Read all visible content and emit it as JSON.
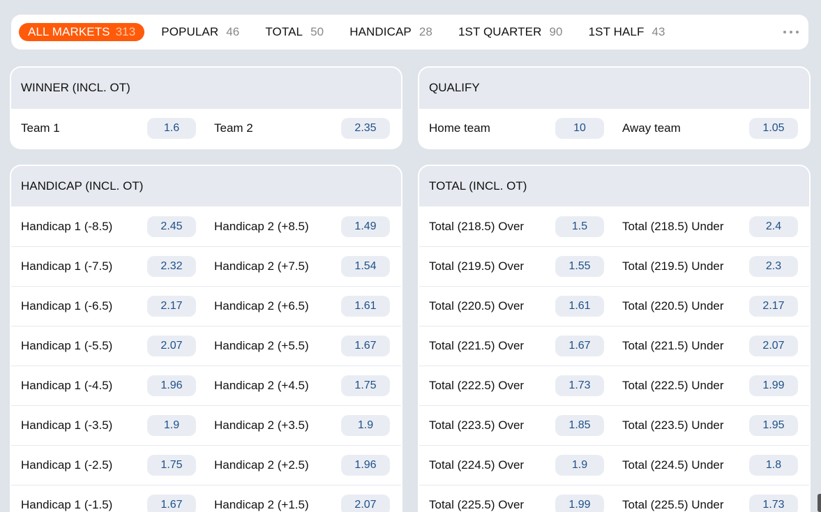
{
  "tabs": [
    {
      "label": "ALL MARKETS",
      "count": "313"
    },
    {
      "label": "POPULAR",
      "count": "46"
    },
    {
      "label": "TOTAL",
      "count": "50"
    },
    {
      "label": "HANDICAP",
      "count": "28"
    },
    {
      "label": "1ST QUARTER",
      "count": "90"
    },
    {
      "label": "1ST HALF",
      "count": "43"
    }
  ],
  "markets": {
    "winner": {
      "title": "WINNER (INCL. OT)",
      "rows": [
        [
          {
            "name": "Team 1",
            "odd": "1.6"
          },
          {
            "name": "Team 2",
            "odd": "2.35"
          }
        ]
      ]
    },
    "qualify": {
      "title": "QUALIFY",
      "rows": [
        [
          {
            "name": "Home team",
            "odd": "10"
          },
          {
            "name": "Away team",
            "odd": "1.05"
          }
        ]
      ]
    },
    "handicap": {
      "title": "HANDICAP (INCL. OT)",
      "rows": [
        [
          {
            "name": "Handicap 1 (-8.5)",
            "odd": "2.45"
          },
          {
            "name": "Handicap 2 (+8.5)",
            "odd": "1.49"
          }
        ],
        [
          {
            "name": "Handicap 1 (-7.5)",
            "odd": "2.32"
          },
          {
            "name": "Handicap 2 (+7.5)",
            "odd": "1.54"
          }
        ],
        [
          {
            "name": "Handicap 1 (-6.5)",
            "odd": "2.17"
          },
          {
            "name": "Handicap 2 (+6.5)",
            "odd": "1.61"
          }
        ],
        [
          {
            "name": "Handicap 1 (-5.5)",
            "odd": "2.07"
          },
          {
            "name": "Handicap 2 (+5.5)",
            "odd": "1.67"
          }
        ],
        [
          {
            "name": "Handicap 1 (-4.5)",
            "odd": "1.96"
          },
          {
            "name": "Handicap 2 (+4.5)",
            "odd": "1.75"
          }
        ],
        [
          {
            "name": "Handicap 1 (-3.5)",
            "odd": "1.9"
          },
          {
            "name": "Handicap 2 (+3.5)",
            "odd": "1.9"
          }
        ],
        [
          {
            "name": "Handicap 1 (-2.5)",
            "odd": "1.75"
          },
          {
            "name": "Handicap 2 (+2.5)",
            "odd": "1.96"
          }
        ],
        [
          {
            "name": "Handicap 1 (-1.5)",
            "odd": "1.67"
          },
          {
            "name": "Handicap 2 (+1.5)",
            "odd": "2.07"
          }
        ]
      ]
    },
    "total": {
      "title": "TOTAL (INCL. OT)",
      "rows": [
        [
          {
            "name": "Total (218.5) Over",
            "odd": "1.5"
          },
          {
            "name": "Total (218.5) Under",
            "odd": "2.4"
          }
        ],
        [
          {
            "name": "Total (219.5) Over",
            "odd": "1.55"
          },
          {
            "name": "Total (219.5) Under",
            "odd": "2.3"
          }
        ],
        [
          {
            "name": "Total (220.5) Over",
            "odd": "1.61"
          },
          {
            "name": "Total (220.5) Under",
            "odd": "2.17"
          }
        ],
        [
          {
            "name": "Total (221.5) Over",
            "odd": "1.67"
          },
          {
            "name": "Total (221.5) Under",
            "odd": "2.07"
          }
        ],
        [
          {
            "name": "Total (222.5) Over",
            "odd": "1.73"
          },
          {
            "name": "Total (222.5) Under",
            "odd": "1.99"
          }
        ],
        [
          {
            "name": "Total (223.5) Over",
            "odd": "1.85"
          },
          {
            "name": "Total (223.5) Under",
            "odd": "1.95"
          }
        ],
        [
          {
            "name": "Total (224.5) Over",
            "odd": "1.9"
          },
          {
            "name": "Total (224.5) Under",
            "odd": "1.8"
          }
        ],
        [
          {
            "name": "Total (225.5) Over",
            "odd": "1.99"
          },
          {
            "name": "Total (225.5) Under",
            "odd": "1.73"
          }
        ]
      ]
    }
  },
  "colors": {
    "accent": "#ff5a0a",
    "odd_text": "#1f4f88",
    "background": "#dfe4ea"
  },
  "icons": {
    "more": "more-horizontal-icon"
  }
}
